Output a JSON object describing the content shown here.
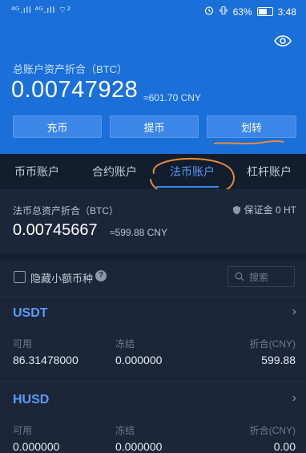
{
  "status_bar": {
    "left": "⁴ᴳ.ıll ⁴ᴳ.ıll  ⌔²",
    "battery_pct": "63%",
    "time": "3:48",
    "battery_level": 0.63
  },
  "hero": {
    "total_label": "总账户资产折合（BTC）",
    "total_btc": "0.00747928",
    "total_cny": "≈601.70 CNY",
    "buttons": [
      "充币",
      "提币",
      "划转"
    ]
  },
  "tabs": [
    "币币账户",
    "合约账户",
    "法币账户",
    "杠杆账户"
  ],
  "active_tab_index": 2,
  "account": {
    "label": "法币总资产折合（BTC）",
    "btc": "0.00745667",
    "cny": "≈599.88 CNY",
    "margin": "保证金 0 HT"
  },
  "filter": {
    "hide_small_label": "隐藏小额币种",
    "search_placeholder": "搜索"
  },
  "coins": [
    {
      "symbol": "USDT",
      "headers": [
        "可用",
        "冻结",
        "折合(CNY)"
      ],
      "available": "86.31478000",
      "frozen": "0.000000",
      "cny_value": "599.88"
    },
    {
      "symbol": "HUSD",
      "headers": [
        "可用",
        "冻结",
        "折合(CNY)"
      ],
      "available": "0.000000",
      "frozen": "0.000000",
      "cny_value": "0.00"
    }
  ],
  "colors": {
    "primary_blue": "#1a6fd9",
    "accent_blue": "#5b9cf3",
    "annotation_orange": "#e98b3a",
    "background": "#1b2638"
  }
}
